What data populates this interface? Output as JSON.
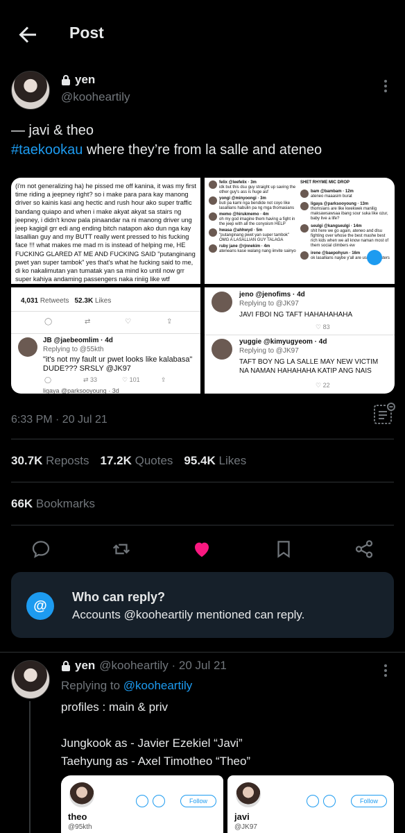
{
  "header": {
    "title": "Post"
  },
  "tweet": {
    "display_name": "yen",
    "handle": "@kooheartily",
    "text_line1": "— javi & theo",
    "hashtag": "#taekookau",
    "text_line2": " where they’re from la salle and ateneo",
    "timestamp": "6:33 PM · 20 Jul 21",
    "stats": {
      "reposts_count": "30.7K",
      "reposts_label": "Reposts",
      "quotes_count": "17.2K",
      "quotes_label": "Quotes",
      "likes_count": "95.4K",
      "likes_label": "Likes",
      "bookmarks_count": "66K",
      "bookmarks_label": "Bookmarks"
    },
    "media": {
      "note_text": "(i'm not generalizing ha) he pissed me off kanina, it was my first time riding a jeepney right? so i make para para kay manong driver so kainis kasi ang hectic and rush hour ako super traffic bandang quiapo and when i make akyat akyat sa stairs ng jeepney, i didn't know pala pinaandar na ni manong driver ung jeep kagigil grr edi ang ending bitch natapon ako dun nga kay lasallian guy and my BUTT really went pressed to his fucking face !!! what makes me mad rn is instead of helping me, HE FUCKING GLARED AT ME AND FUCKING SAID \"putanginang pwet yan super tambok\" yes that's what he fucking said to me, di ko nakalimutan yan tumatak yan sa mind ko until now grr super kahiya andaming passengers naka riniig like wtf ??????? is ?? ur ?? problem ??? bro ??? if i meet you again, you'll be dead as",
      "cell_b_header": "SHET RHYME MIC DROP",
      "cell_b_user1": "felix @leefelix · 3m",
      "cell_b_text1": "idk but this dsu guy straight up saving the other guy's ass is huge asf",
      "cell_b_user2": "yongi @minyoongi · 3m",
      "cell_b_text2": "buti pa kami nga bendide not coyo like lasallians habulin pa ng mga thomasians",
      "cell_b_user3": "memo @hirukmemo · 4m",
      "cell_b_text3": "oh my god imagine them having a fight in the jeep with all the conyoism HELP",
      "cell_b_user4": "hwasa @ahhwyd · 5m",
      "cell_b_text4": "\"putanginang pwet yan super tambok\" OMG A LASALLIAN GUY TALAGA",
      "cell_b_user5": "ruby jane @rjnnekim · 4m",
      "cell_b_text5": "ateneans kase walang nang iinvite sainyo",
      "cell_b_user6": "bam @bambam · 12m",
      "cell_b_text6": "ateneo maaasim burat",
      "cell_b_user7": "ligaya @parksooyoung · 13m",
      "cell_b_text7": "thomsians are like kwekwek manilig maksawsawsaa ibang sour suka like ozur, baby live a life?",
      "cell_b_user8": "seulgi @kangseulgi · 14m",
      "cell_b_text8": "shit here we go again, ateneo and dlsu fighting over whose the best mashe best rich kids when we all know naman most of them social climbers ew",
      "cell_b_user9": "irene @baepohyun · 16m",
      "cell_b_text9": "ok lasallians naybe y'all are usap monsters",
      "cell_c_retweets_count": "4,031",
      "cell_c_retweets_label": "Retweets",
      "cell_c_likes_count": "52.3K",
      "cell_c_likes_label": "Likes",
      "cell_c_user": "JB @jaebeomlim · 4d",
      "cell_c_replying": "Replying to @55kth",
      "cell_c_text": "\"it's not my fault ur pwet looks like kalabasa\" DUDE??? SRSLY @JK97",
      "cell_c_rt": "33",
      "cell_c_likes": "101",
      "cell_c_next": "ligaya @parksooyoung · 3d",
      "cell_d_user1": "jeno @jenofims · 4d",
      "cell_d_replying1": "Replying to @JK97",
      "cell_d_text1": "JAVI FBOI NG TAFT HAHAHAHAHA",
      "cell_d_likes1": "83",
      "cell_d_user2": "yuggie @kimyugyeom · 4d",
      "cell_d_replying2": "Replying to @JK97",
      "cell_d_text2": "TAFT BOY NG LA SALLE MAY NEW VICTIM NA NAMAN HAHAHAHA KATIP ANG NAIS",
      "cell_d_likes2": "22"
    }
  },
  "reply_restriction": {
    "icon": "@",
    "title": "Who can reply?",
    "description": "Accounts @kooheartily mentioned can reply."
  },
  "reply": {
    "display_name": "yen",
    "handle_date": "@kooheartily · 20 Jul 21",
    "replying_prefix": "Replying to ",
    "replying_handle": "@kooheartily",
    "body": "profiles : main & priv\n\nJungkook as - Javier Ezekiel “Javi”\nTaehyung as - Axel Timotheo “Theo”",
    "cards": [
      {
        "name": "theo",
        "handle": "@95kth",
        "follow_label": "Follow"
      },
      {
        "name": "javi",
        "handle": "@JK97",
        "follow_label": "Follow"
      }
    ]
  },
  "colors": {
    "accent": "#1d9bf0",
    "like": "#f91880",
    "muted": "#71767b",
    "text": "#e7e9ea",
    "card_bg": "#16202a"
  },
  "icons": [
    "back-arrow-icon",
    "lock-icon",
    "more-icon",
    "analytics-icon",
    "reply-icon",
    "repost-icon",
    "like-icon",
    "bookmark-icon",
    "share-icon"
  ]
}
